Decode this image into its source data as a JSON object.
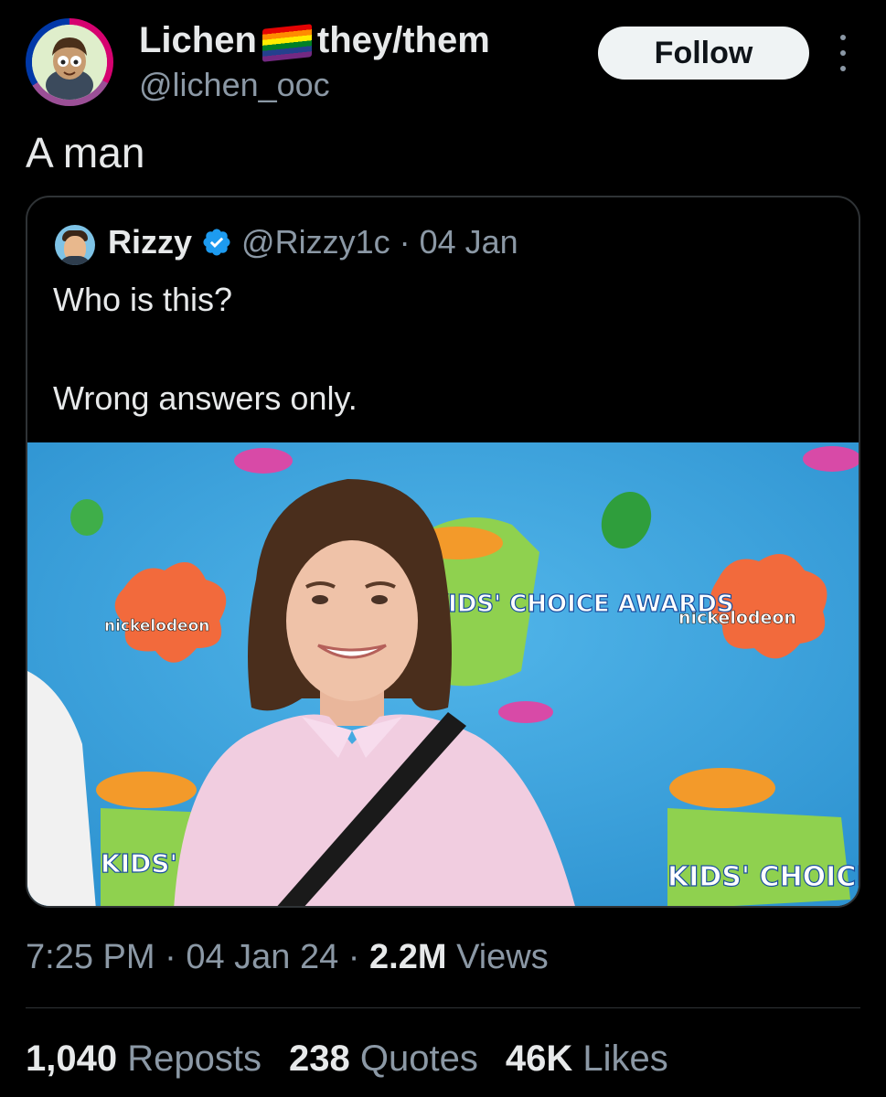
{
  "author": {
    "display_name": "Lichen",
    "pronouns": "they/them",
    "handle": "@lichen_ooc"
  },
  "follow_label": "Follow",
  "tweet_text": "A man",
  "quoted": {
    "name": "Rizzy",
    "handle": "@Rizzy1c",
    "separator": "·",
    "date": "04 Jan",
    "line1": "Who is this?",
    "line2": "Wrong answers only.",
    "photo_text": {
      "logo_left": "nickelodeon",
      "logo_right": "nickelodeon",
      "kca_mid": "KIDS' CHOICE AWARDS",
      "kca_left": "KIDS' CHOICE",
      "kca_right": "KIDS' CHOICE"
    }
  },
  "meta": {
    "time": "7:25 PM",
    "date": "04 Jan 24",
    "views_count": "2.2M",
    "views_label": "Views",
    "sep": "·"
  },
  "stats": {
    "reposts_count": "1,040",
    "reposts_label": "Reposts",
    "quotes_count": "238",
    "quotes_label": "Quotes",
    "likes_count": "46K",
    "likes_label": "Likes"
  },
  "colors": {
    "background": "#000000",
    "muted": "#8b98a5",
    "verified": "#1d9bf0",
    "splat": "#f26a3c",
    "photo_bg": "#3ca4df"
  }
}
